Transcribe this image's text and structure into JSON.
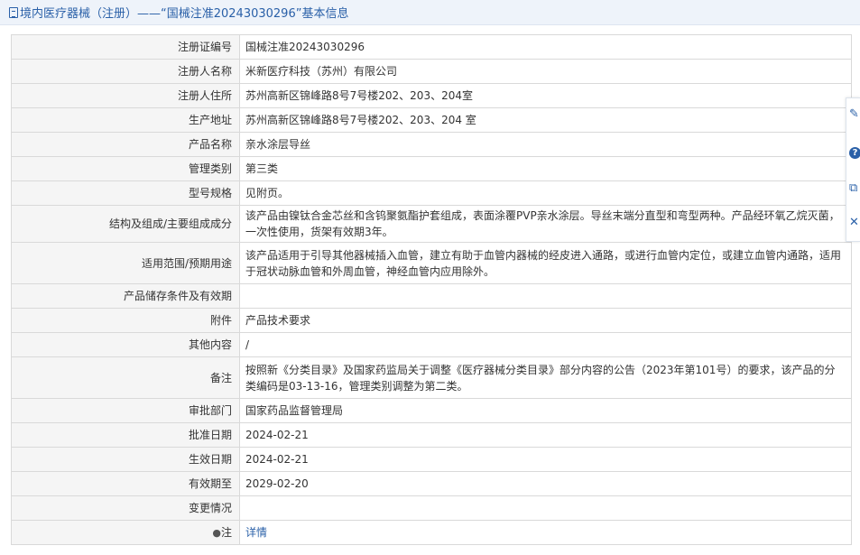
{
  "header": {
    "title": "境内医疗器械（注册）——“国械注准20243030296”基本信息"
  },
  "rows": [
    {
      "label": "注册证编号",
      "value": "国械注准20243030296"
    },
    {
      "label": "注册人名称",
      "value": "米新医疗科技（苏州）有限公司"
    },
    {
      "label": "注册人住所",
      "value": "苏州高新区锦峰路8号7号楼202、203、204室"
    },
    {
      "label": "生产地址",
      "value": "苏州高新区锦峰路8号7号楼202、203、204 室"
    },
    {
      "label": "产品名称",
      "value": "亲水涂层导丝"
    },
    {
      "label": "管理类别",
      "value": "第三类"
    },
    {
      "label": "型号规格",
      "value": "见附页。"
    },
    {
      "label": "结构及组成/主要组成成分",
      "value": "该产品由镍钛合金芯丝和含钨聚氨酯护套组成，表面涂覆PVP亲水涂层。导丝末端分直型和弯型两种。产品经环氧乙烷灭菌，一次性使用，货架有效期3年。"
    },
    {
      "label": "适用范围/预期用途",
      "value": "该产品适用于引导其他器械插入血管，建立有助于血管内器械的经皮进入通路，或进行血管内定位，或建立血管内通路，适用于冠状动脉血管和外周血管，神经血管内应用除外。"
    },
    {
      "label": "产品储存条件及有效期",
      "value": ""
    },
    {
      "label": "附件",
      "value": "产品技术要求"
    },
    {
      "label": "其他内容",
      "value": "/"
    },
    {
      "label": "备注",
      "value": "按照新《分类目录》及国家药监局关于调整《医疗器械分类目录》部分内容的公告（2023年第101号）的要求，该产品的分类编码是03-13-16，管理类别调整为第二类。"
    },
    {
      "label": "审批部门",
      "value": "国家药品监督管理局"
    },
    {
      "label": "批准日期",
      "value": "2024-02-21"
    },
    {
      "label": "生效日期",
      "value": "2024-02-21"
    },
    {
      "label": "有效期至",
      "value": "2029-02-20"
    },
    {
      "label": "变更情况",
      "value": ""
    },
    {
      "label": "注",
      "value": "详情"
    }
  ],
  "side_tools": [
    {
      "icon": "edit-icon"
    },
    {
      "icon": "help-icon"
    },
    {
      "icon": "copy-icon"
    },
    {
      "icon": "close-icon"
    }
  ]
}
